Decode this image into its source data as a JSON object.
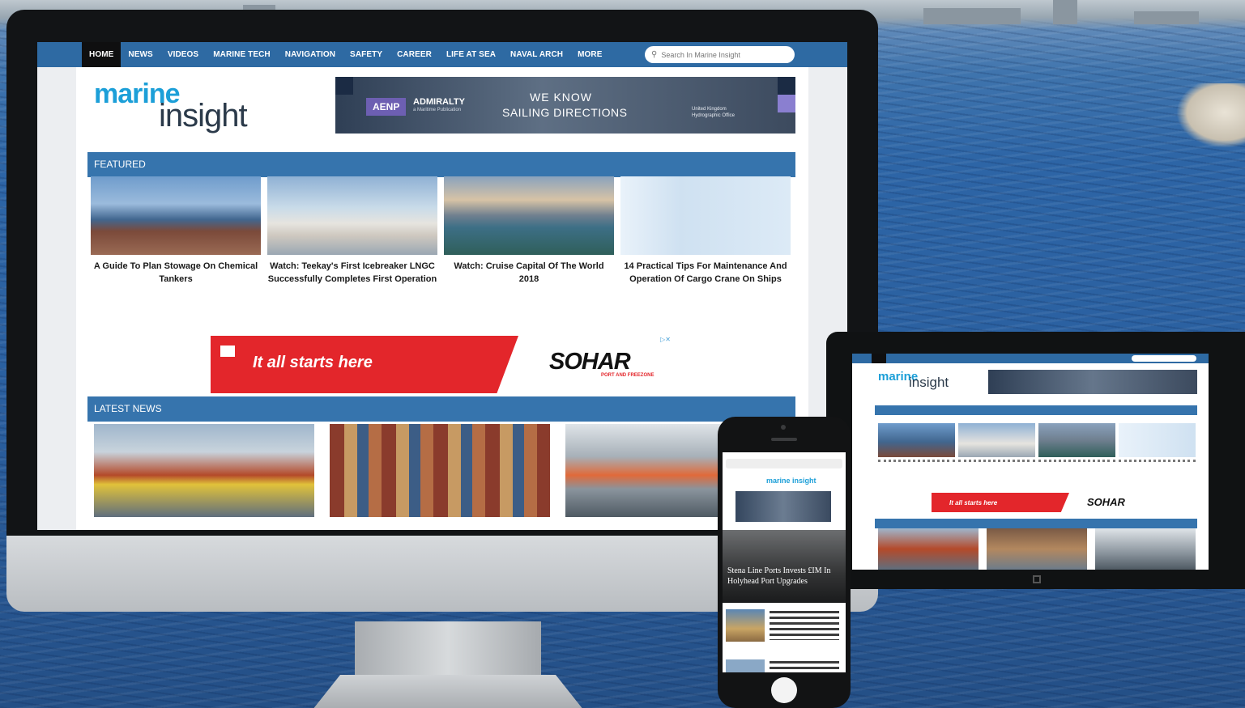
{
  "nav": {
    "items": [
      "HOME",
      "NEWS",
      "VIDEOS",
      "MARINE TECH",
      "NAVIGATION",
      "SAFETY",
      "CAREER",
      "LIFE AT SEA",
      "NAVAL ARCH",
      "MORE"
    ],
    "active": "HOME",
    "search_placeholder": "Search In Marine Insight"
  },
  "logo": {
    "part1": "marine",
    "part2": "insight"
  },
  "banner_ad": {
    "tag": "AENP",
    "brand": "ADMIRALTY",
    "brand_sub": "a Maritime Publication",
    "headline_line1": "WE KNOW",
    "headline_line2": "SAILING DIRECTIONS",
    "office": "United Kingdom Hydrographic Office"
  },
  "sections": {
    "featured": "FEATURED",
    "latest": "LATEST NEWS"
  },
  "featured": [
    {
      "title": "A Guide To Plan Stowage On Chemical Tankers"
    },
    {
      "title": "Watch: Teekay's First Icebreaker LNGC Successfully Completes First Operation"
    },
    {
      "title": "Watch: Cruise Capital Of The World 2018"
    },
    {
      "title": "14 Practical Tips For Maintenance And Operation Of Cargo Crane On Ships"
    }
  ],
  "ad_strip": {
    "slogan": "It all starts here",
    "brand": "SOHAR",
    "brand_sub": "PORT AND FREEZONE"
  },
  "tablet": {
    "logo": "marine",
    "logo2": "insight",
    "slogan": "It all starts here",
    "brand": "SOHAR"
  },
  "phone": {
    "logo": "marine insight",
    "hero_title": "Stena Line Ports Invests £IM In Holyhead Port Upgrades"
  }
}
